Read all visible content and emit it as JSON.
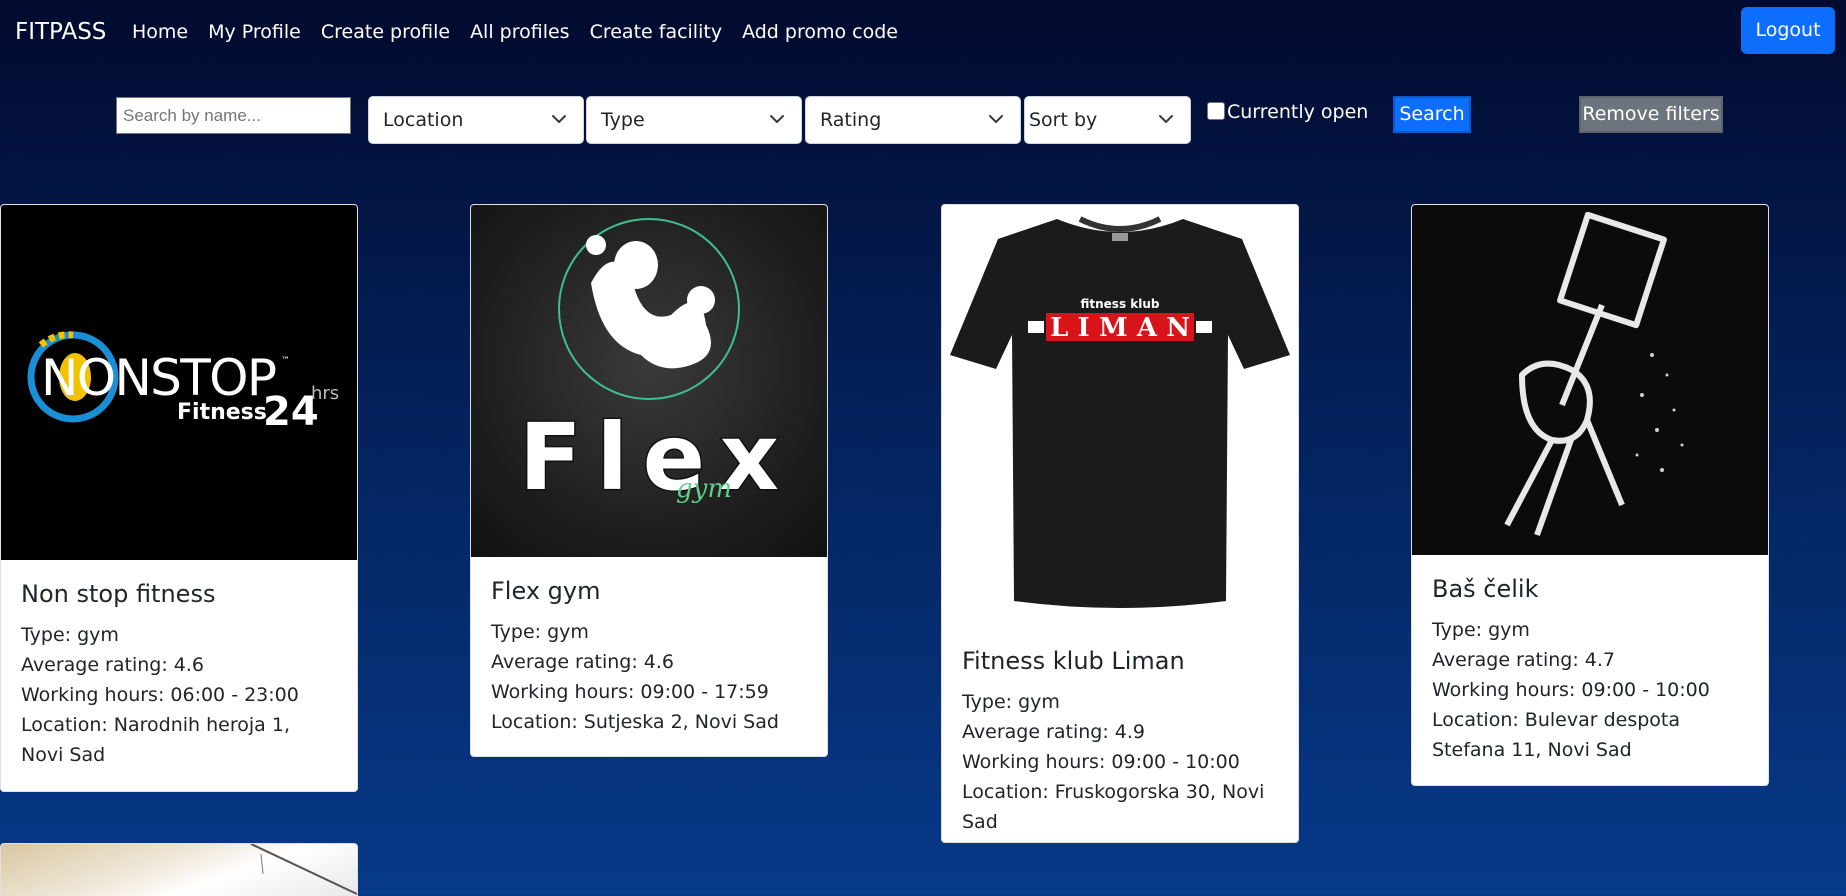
{
  "nav": {
    "brand": "FITPASS",
    "links": [
      "Home",
      "My Profile",
      "Create profile",
      "All profiles",
      "Create facility",
      "Add promo code"
    ],
    "logout": "Logout"
  },
  "filters": {
    "search_placeholder": "Search by name...",
    "location": "Location",
    "type": "Type",
    "rating": "Rating",
    "sort": "Sort by",
    "currently_open": "Currently open",
    "search_button": "Search",
    "remove_button": "Remove filters"
  },
  "facilities": [
    {
      "name": "Non stop fitness",
      "type": "Type: gym",
      "rating": "Average rating: 4.6",
      "hours": "Working hours: 06:00 - 23:00",
      "location": "Location: Narodnih heroja 1, Novi Sad",
      "logo": {
        "word1": "NONSTOP",
        "tm": "™",
        "word2": "Fitness",
        "num": "24",
        "hrs": "hrs"
      }
    },
    {
      "name": "Flex gym",
      "type": "Type: gym",
      "rating": "Average rating: 4.6",
      "hours": "Working hours: 09:00 - 17:59",
      "location": "Location: Sutjeska 2, Novi Sad",
      "logo": {
        "word": "Flex",
        "script": "gym"
      }
    },
    {
      "name": "Fitness klub Liman",
      "type": "Type: gym",
      "rating": "Average rating: 4.9",
      "hours": "Working hours: 09:00 - 10:00",
      "location": "Location: Fruskogorska 30, Novi Sad",
      "logo": {
        "small": "fitness klub",
        "big": "LIMAN"
      }
    },
    {
      "name": "Baš čelik",
      "type": "Type: gym",
      "rating": "Average rating: 4.7",
      "hours": "Working hours: 09:00 - 10:00",
      "location": "Location: Bulevar despota Stefana 11, Novi Sad"
    }
  ],
  "colors": {
    "primary": "#0d6efd",
    "secondary": "#6c757d",
    "bg_top": "#020a2e",
    "bg_bottom": "#063a8a"
  }
}
